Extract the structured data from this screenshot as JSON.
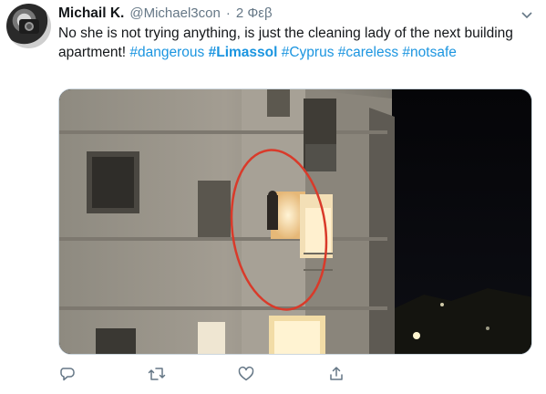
{
  "tweet": {
    "author_name": "Michail K.",
    "author_handle": "@Michael3con",
    "separator": "·",
    "time": "2 Φεβ",
    "text_prefix": "No she is not trying anything, is just the cleaning lady of the next building apartment!",
    "hashtags": [
      "#dangerous",
      "#Limassol",
      "#Cyprus",
      "#careless",
      "#notsafe"
    ],
    "accent_color": "#1b95e0",
    "media_highlight_color": "#d93a2a"
  },
  "icons": {
    "menu": "chevron-down-icon",
    "reply": "reply-icon",
    "retweet": "retweet-icon",
    "like": "heart-icon",
    "share": "share-icon"
  }
}
